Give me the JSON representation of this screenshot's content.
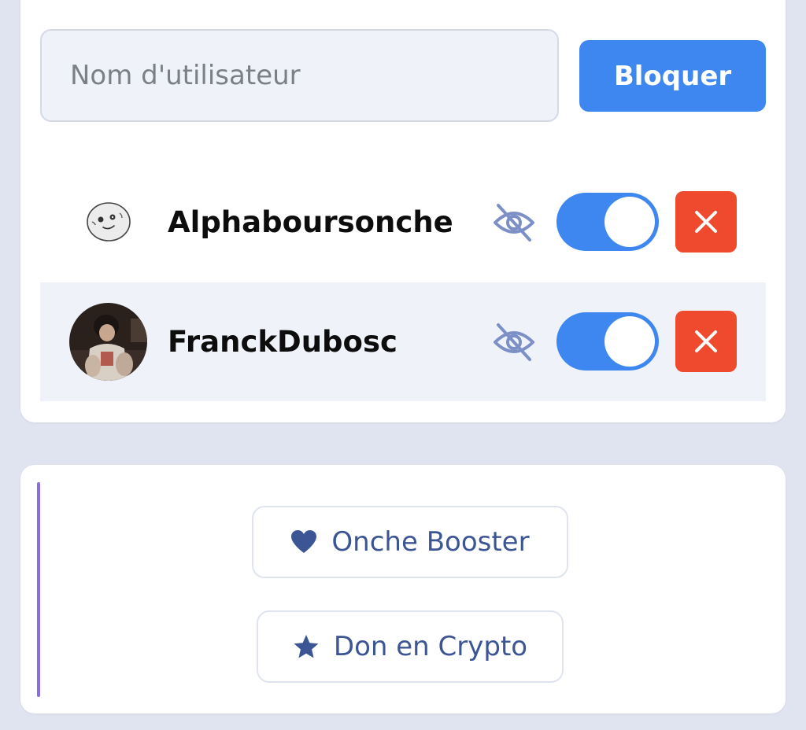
{
  "block_form": {
    "username_placeholder": "Nom d'utilisateur",
    "username_value": "",
    "block_label": "Bloquer"
  },
  "blocked_users": [
    {
      "name": "Alphaboursonche",
      "avatar": "sketch-face-avatar",
      "hidden": true,
      "enabled": true
    },
    {
      "name": "FranckDubosc",
      "avatar": "photo-avatar",
      "hidden": true,
      "enabled": true
    }
  ],
  "support_links": [
    {
      "label": "Onche Booster",
      "icon": "heart-icon"
    },
    {
      "label": "Don en Crypto",
      "icon": "star-icon"
    }
  ],
  "colors": {
    "accent_blue": "#3f87f0",
    "delete_red": "#f04a2e",
    "link_text": "#3c5595",
    "accent_purple": "#8a6be6",
    "eye_icon": "#7c8fc6"
  }
}
